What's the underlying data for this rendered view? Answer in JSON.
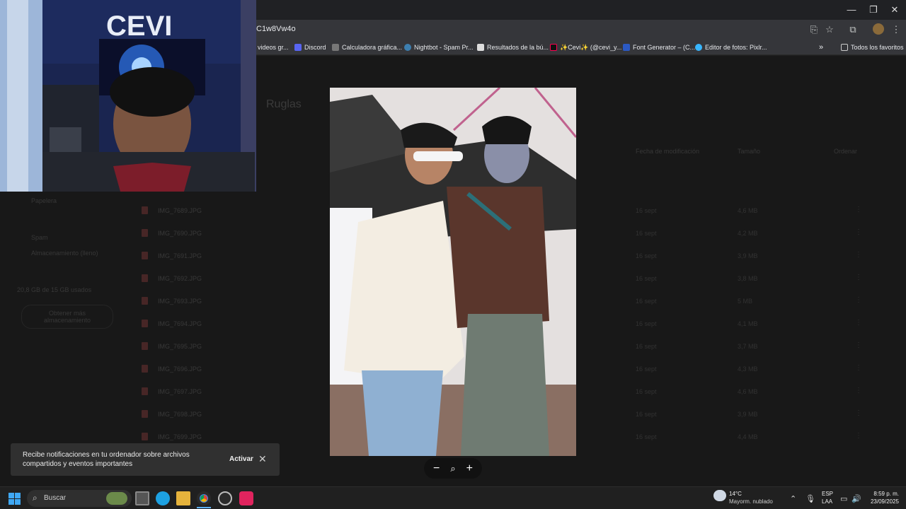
{
  "browser": {
    "url": "C1w8Vw4o",
    "window_controls": [
      "—",
      "❐",
      "✕"
    ],
    "bookmarks": [
      {
        "label": "videos gr...",
        "color": "#888888"
      },
      {
        "label": "Discord",
        "color": "#5865f2"
      },
      {
        "label": "Calculadora gráfica...",
        "color": "#999999"
      },
      {
        "label": "Nightbot - Spam Pr...",
        "color": "#3d7fb0"
      },
      {
        "label": "Resultados de la bú...",
        "color": "#dddddd"
      },
      {
        "label": "✨Cevi✨ (@cevi_y...",
        "color": "#111111"
      },
      {
        "label": "Font Generator – (C...",
        "color": "#2b59c3"
      },
      {
        "label": "Editor de fotos: Pixlr...",
        "color": "#38b6ff"
      }
    ],
    "bookmarks_more": "»",
    "all_bookmarks": "Todos los favoritos"
  },
  "drive": {
    "title": "Ruglas",
    "columns": {
      "modified": "Fecha de modificación",
      "size": "Tamaño",
      "sort": "Ordenar"
    },
    "sidebar": [
      "Papelera",
      "Spam",
      "Almacenamiento (lleno)",
      "20,8 GB de 15 GB usados",
      "Obtener más almacenamiento"
    ],
    "files": [
      {
        "name": "IMG_7689.JPG",
        "date": "16 sept",
        "size": "4,6 MB"
      },
      {
        "name": "IMG_7690.JPG",
        "date": "16 sept",
        "size": "4,2 MB"
      },
      {
        "name": "IMG_7691.JPG",
        "date": "16 sept",
        "size": "3,9 MB"
      },
      {
        "name": "IMG_7692.JPG",
        "date": "16 sept",
        "size": "3,8 MB"
      },
      {
        "name": "IMG_7693.JPG",
        "date": "16 sept",
        "size": "5 MB"
      },
      {
        "name": "IMG_7694.JPG",
        "date": "16 sept",
        "size": "4,1 MB"
      },
      {
        "name": "IMG_7695.JPG",
        "date": "16 sept",
        "size": "3,7 MB"
      },
      {
        "name": "IMG_7696.JPG",
        "date": "16 sept",
        "size": "4,3 MB"
      },
      {
        "name": "IMG_7697.JPG",
        "date": "16 sept",
        "size": "4,6 MB"
      },
      {
        "name": "IMG_7698.JPG",
        "date": "16 sept",
        "size": "3,9 MB"
      },
      {
        "name": "IMG_7699.JPG",
        "date": "16 sept",
        "size": "4,4 MB"
      }
    ]
  },
  "viewer": {
    "zoom_out": "−",
    "zoom_icon": "magnifier-icon",
    "zoom_in": "+"
  },
  "notification": {
    "text": "Recibe notificaciones en tu ordenador sobre archivos compartidos y eventos importantes",
    "action": "Activar",
    "close": "✕"
  },
  "taskbar": {
    "search_placeholder": "Buscar",
    "weather_temp": "14°C",
    "weather_desc": "Mayorm. nublado",
    "lang_top": "ESP",
    "lang_bottom": "LAA",
    "time": "8:59 p. m.",
    "date": "23/09/2025"
  }
}
